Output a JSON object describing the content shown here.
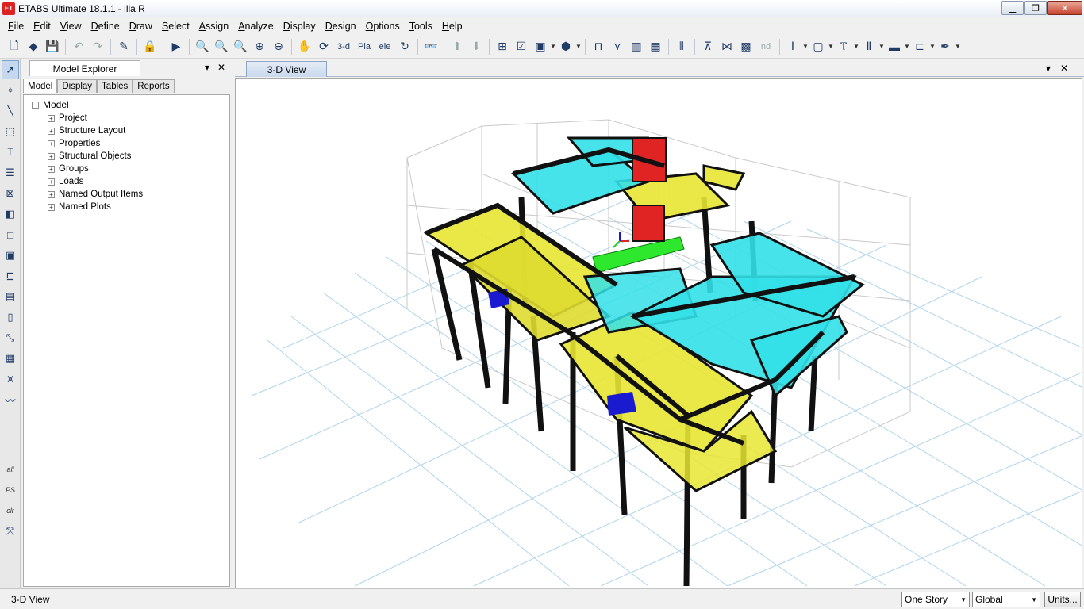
{
  "window": {
    "title": "ETABS Ultimate 18.1.1 - illa R",
    "app_badge": "ET",
    "colors": {
      "accent": "#c7432d",
      "slab_yellow": "#e8e633",
      "slab_cyan": "#33e0e8",
      "slab_green": "#2ee82e",
      "wall_red": "#e02424"
    }
  },
  "menu": [
    {
      "label": "File",
      "key": "F",
      "rest": "ile"
    },
    {
      "label": "Edit",
      "key": "E",
      "rest": "dit"
    },
    {
      "label": "View",
      "key": "V",
      "rest": "iew"
    },
    {
      "label": "Define",
      "key": "D",
      "rest": "efine"
    },
    {
      "label": "Draw",
      "key": "D",
      "rest": "raw"
    },
    {
      "label": "Select",
      "key": "S",
      "rest": "elect"
    },
    {
      "label": "Assign",
      "key": "A",
      "rest": "ssign"
    },
    {
      "label": "Analyze",
      "key": "A",
      "rest": "nalyze"
    },
    {
      "label": "Display",
      "key": "D",
      "rest": "isplay"
    },
    {
      "label": "Design",
      "key": "D",
      "rest": "esign"
    },
    {
      "label": "Options",
      "key": "O",
      "rest": "ptions"
    },
    {
      "label": "Tools",
      "key": "T",
      "rest": "ools"
    },
    {
      "label": "Help",
      "key": "H",
      "rest": "elp"
    }
  ],
  "toolbar": {
    "view_3d_label": "3-d",
    "plan_label": "Pla",
    "elev_label": "ele",
    "nd_label": "nd"
  },
  "lefttools": {
    "all_label": "all",
    "ps_label": "PS",
    "clr_label": "clr"
  },
  "explorer": {
    "title": "Model Explorer",
    "tabs": [
      "Model",
      "Display",
      "Tables",
      "Reports"
    ],
    "root": "Model",
    "nodes": [
      "Project",
      "Structure Layout",
      "Properties",
      "Structural Objects",
      "Groups",
      "Loads",
      "Named Output Items",
      "Named Plots"
    ]
  },
  "view": {
    "tab_label": "3-D View"
  },
  "status": {
    "text": "3-D View",
    "story_select": "One Story",
    "coord_select": "Global",
    "units_button": "Units..."
  }
}
